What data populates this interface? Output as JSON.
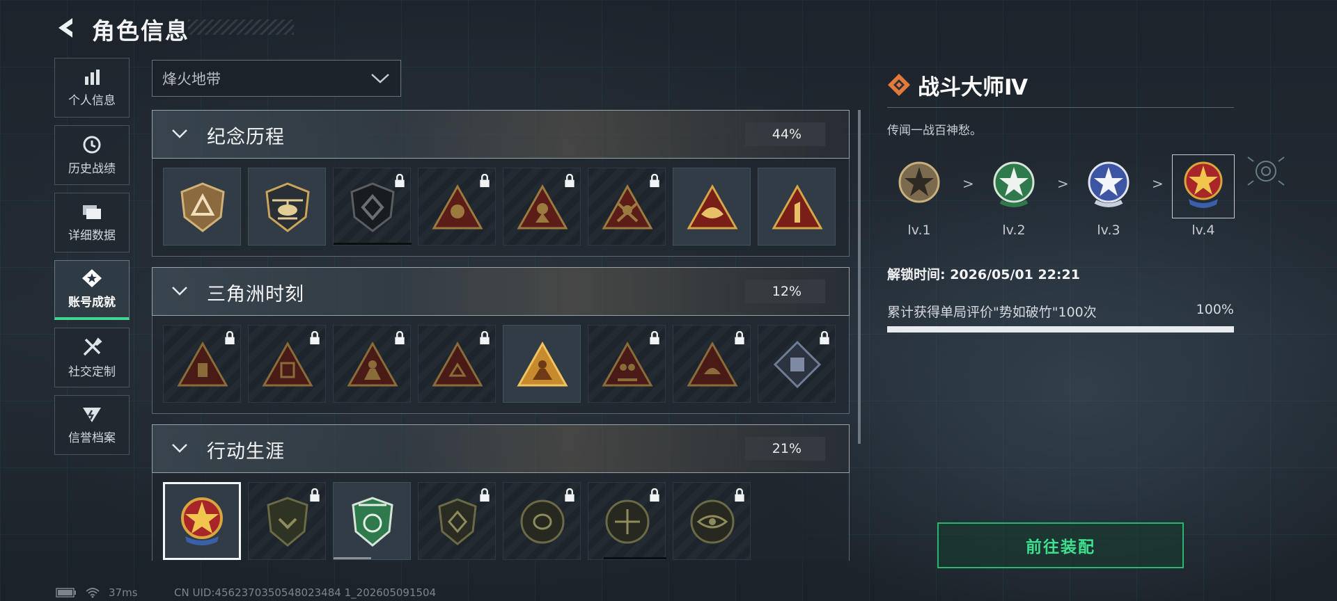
{
  "header": {
    "title": "角色信息"
  },
  "sidebar": {
    "items": [
      {
        "label": "个人信息",
        "icon": "bar-chart-icon"
      },
      {
        "label": "历史战绩",
        "icon": "clock-icon"
      },
      {
        "label": "详细数据",
        "icon": "folders-icon"
      },
      {
        "label": "账号成就",
        "icon": "achievement-icon",
        "active": true
      },
      {
        "label": "社交定制",
        "icon": "tools-icon"
      },
      {
        "label": "信誉档案",
        "icon": "reputation-icon"
      }
    ]
  },
  "mode_select": {
    "value": "烽火地带"
  },
  "categories": [
    {
      "name": "纪念历程",
      "percent": "44%"
    },
    {
      "name": "三角洲时刻",
      "percent": "12%"
    },
    {
      "name": "行动生涯",
      "percent": "21%"
    }
  ],
  "detail": {
    "title": "战斗大师Ⅳ",
    "description": "传闻一战百神愁。",
    "levels": [
      "lv.1",
      "lv.2",
      "lv.3",
      "lv.4"
    ],
    "arrow": ">",
    "unlock_time": "解锁时间: 2026/05/01 22:21",
    "task": {
      "text": "累计获得单局评价\"势如破竹\"100次",
      "percent": "100%",
      "progress": 1.0
    },
    "equip_button": "前往装配"
  },
  "footer": {
    "ping": "37ms",
    "uid": "CN UID:4562370350548023484 1_202605091504"
  },
  "colors": {
    "accent_green": "#3fd792",
    "equip_border": "#27b86f",
    "badge_gold": "#c9a65a",
    "badge_red": "#8a2a22"
  }
}
